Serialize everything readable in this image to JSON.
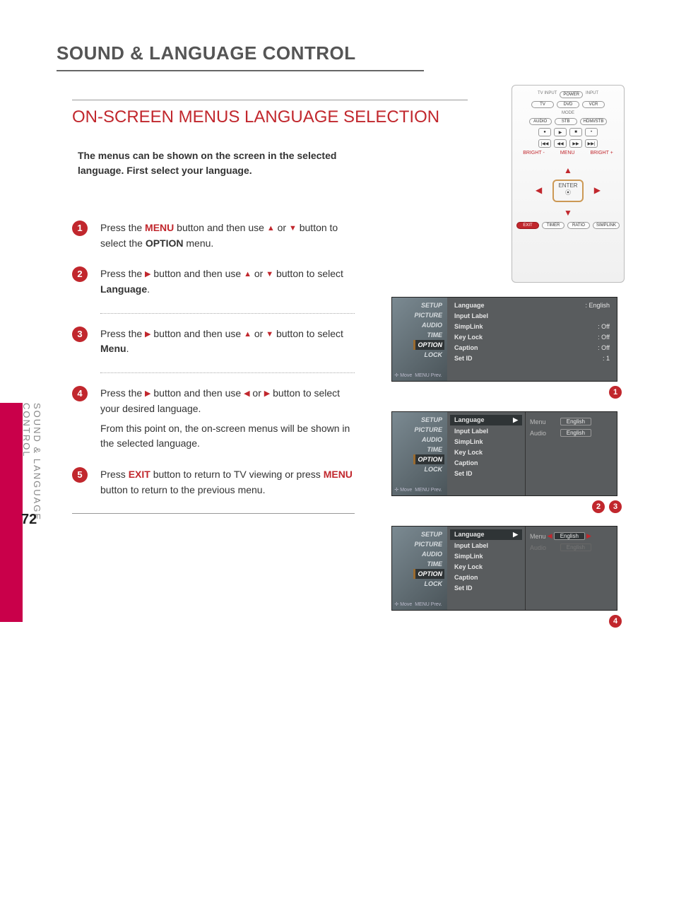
{
  "page_number": "72",
  "title": "SOUND & LANGUAGE CONTROL",
  "subtitle": "ON-SCREEN MENUS  LANGUAGE SELECTION",
  "intro": "The menus can be shown on the screen in the selected language. First select your language.",
  "vertical_label": "SOUND & LANGUAGE CONTROL",
  "steps": {
    "s1a": "Press the ",
    "s1menu": "MENU",
    "s1b": " button and then use ",
    "s1c": " or ",
    "s1d": " button to select the ",
    "s1option": "OPTION",
    "s1e": " menu.",
    "s2a": "Press the ",
    "s2b": " button and then use ",
    "s2c": " or ",
    "s2d": " button to select ",
    "s2lang": "Language",
    "s2e": ".",
    "s3a": "Press the ",
    "s3b": " button and then use ",
    "s3c": " or ",
    "s3d": " button to select ",
    "s3menu": "Menu",
    "s3e": ".",
    "s4a": "Press the ",
    "s4b": " button and then use ",
    "s4c": " or ",
    "s4d": " button to select your desired language.",
    "s4note": "From this point on, the on-screen menus will be shown in the selected language.",
    "s5a": "Press ",
    "s5exit": "EXIT",
    "s5b": " button to return to TV viewing or press ",
    "s5menu": "MENU",
    "s5c": " button to return to the previous menu."
  },
  "remote": {
    "tvinput": "TV INPUT",
    "power": "POWER",
    "input": "INPUT",
    "tv": "TV",
    "dvd": "DVD",
    "vcr": "VCR",
    "mode": "MODE",
    "audio": "AUDIO",
    "stb": "STB",
    "hdmistb": "HDMI/STB",
    "bright_minus": "BRIGHT -",
    "menu": "MENU",
    "bright_plus": "BRIGHT +",
    "enter": "ENTER",
    "exit": "EXIT",
    "timer": "TIMER",
    "ratio": "RATIO",
    "simplink": "SIMPLINK"
  },
  "osd_side_items": [
    "SETUP",
    "PICTURE",
    "AUDIO",
    "TIME",
    "OPTION",
    "LOCK"
  ],
  "osd_side_hint_move": "Move",
  "osd_side_hint_prev": "MENU Prev.",
  "fig1_rows": [
    {
      "k": "Language",
      "v": ": English"
    },
    {
      "k": "Input Label",
      "v": ""
    },
    {
      "k": "SimpLink",
      "v": ": Off"
    },
    {
      "k": "Key Lock",
      "v": ": Off"
    },
    {
      "k": "Caption",
      "v": ": Off"
    },
    {
      "k": "Set ID",
      "v": ": 1"
    }
  ],
  "fig2_mid_rows": [
    "Language",
    "Input Label",
    "SimpLink",
    "Key Lock",
    "Caption",
    "Set ID"
  ],
  "fig2_right": {
    "menu_lbl": "Menu",
    "menu_val": "English",
    "audio_lbl": "Audio",
    "audio_val": "English"
  },
  "fig3_right": {
    "menu_lbl": "Menu",
    "menu_val": "English",
    "audio_lbl": "Audio",
    "audio_val": "English"
  },
  "badges": {
    "b1": "1",
    "b2": "2",
    "b3": "3",
    "b4": "4",
    "b5": "5"
  }
}
